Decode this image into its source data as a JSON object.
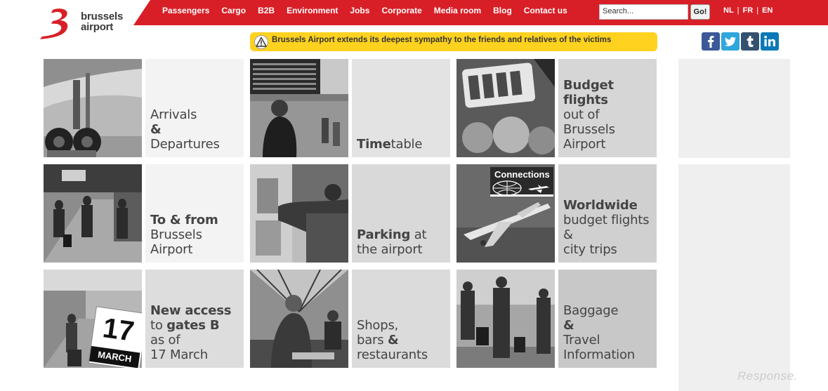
{
  "brand": {
    "line1": "brussels",
    "line2": "airport"
  },
  "nav": [
    "Passengers",
    "Cargo",
    "B2B",
    "Environment",
    "Jobs",
    "Corporate",
    "Media room",
    "Blog",
    "Contact us"
  ],
  "search": {
    "placeholder": "Search...",
    "value": "Search...",
    "button": "Go!"
  },
  "languages": [
    "NL",
    "FR",
    "EN"
  ],
  "alert": {
    "text": "Brussels Airport extends its deepest sympathy to the friends and relatives of the victims"
  },
  "social": [
    "facebook-icon",
    "twitter-icon",
    "tumblr-icon",
    "linkedin-icon"
  ],
  "tiles": [
    {
      "parts": [
        {
          "t": "Arrivals",
          "b": false
        },
        {
          "t": "&",
          "b": true
        },
        {
          "t": "Departures",
          "b": false
        }
      ],
      "photo": "landing-gear"
    },
    {
      "parts": [
        {
          "t": "Time",
          "b": true
        },
        {
          "t": "table",
          "b": false
        }
      ],
      "photo": "departure-board"
    },
    {
      "parts": [
        {
          "t": "Budget",
          "b": true
        },
        {
          "t": "flights",
          "b": true
        },
        {
          "t": "out of",
          "b": false
        },
        {
          "t": "Brussels",
          "b": false
        },
        {
          "t": "Airport",
          "b": false
        }
      ],
      "photo": "bruxx"
    },
    {
      "parts": [
        {
          "t": "To & from",
          "b": true
        },
        {
          "t": "Brussels",
          "b": false
        },
        {
          "t": "Airport",
          "b": false
        }
      ],
      "photo": "train-station"
    },
    {
      "parts": [
        {
          "t": "Parking",
          "b": true
        },
        {
          "t": " at",
          "b": false
        },
        {
          "t": "the airport",
          "b": false
        }
      ],
      "photo": "parking-machine"
    },
    {
      "parts": [
        {
          "t": "Worldwide",
          "b": true
        },
        {
          "t": "budget flights",
          "b": false
        },
        {
          "t": "&",
          "b": false
        },
        {
          "t": "city trips",
          "b": false
        }
      ],
      "photo": "airplane",
      "badge": "Connections"
    },
    {
      "parts": [
        {
          "t": "New access",
          "b": true
        },
        {
          "t": "to ",
          "b": false
        },
        {
          "t": "gates B",
          "b": true
        },
        {
          "t": "as of",
          "b": false
        },
        {
          "t": "17 March",
          "b": false
        }
      ],
      "photo": "calendar",
      "calendar": {
        "day": "17",
        "month": "MARCH"
      }
    },
    {
      "parts": [
        {
          "t": "Shops,",
          "b": false
        },
        {
          "t": "bars ",
          "b": false
        },
        {
          "t": "&",
          "b": true
        },
        {
          "t": "restaurants",
          "b": false
        }
      ],
      "photo": "bar"
    },
    {
      "parts": [
        {
          "t": "Baggage",
          "b": false
        },
        {
          "t": "&",
          "b": true
        },
        {
          "t": "Travel",
          "b": false
        },
        {
          "t": "Information",
          "b": false
        }
      ],
      "photo": "travellers"
    }
  ],
  "watermark": "Response."
}
